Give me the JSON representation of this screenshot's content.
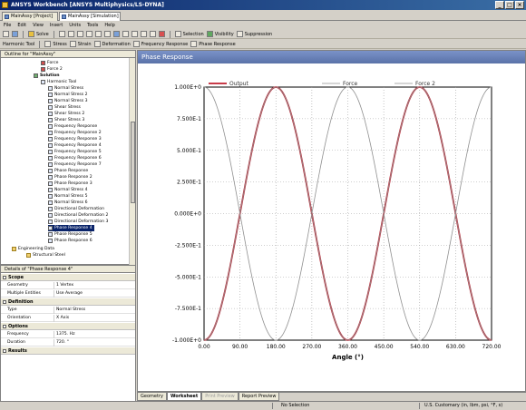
{
  "window": {
    "title": "ANSYS Workbench [ANSYS Multiphysics/LS-DYNA]"
  },
  "project_tabs": [
    {
      "label": "MainAssy [Project]"
    },
    {
      "label": "MainAssy [Simulation]"
    }
  ],
  "menu": [
    "File",
    "Edit",
    "View",
    "Insert",
    "Units",
    "Tools",
    "Help"
  ],
  "toolbar1": {
    "solve_label": "Solve",
    "selection_label": "Selection",
    "visibility_label": "Visibility",
    "suppression_label": "Suppression"
  },
  "toolbar2": {
    "context_label": "Harmonic Tool",
    "stress_label": "Stress",
    "strain_label": "Strain",
    "deformation_label": "Deformation",
    "freq_response_label": "Frequency Response",
    "phase_response_label": "Phase Response"
  },
  "outline": {
    "header": "Outline for \"MainAssy\"",
    "items": [
      {
        "label": "Force",
        "indent": 5,
        "icon": "force-icon"
      },
      {
        "label": "Force 2",
        "indent": 5,
        "icon": "force-icon"
      },
      {
        "label": "Solution",
        "indent": 4,
        "icon": "solution-icon",
        "bold": true
      },
      {
        "label": "Harmonic Tool",
        "indent": 5,
        "icon": "harmonic-tool-icon"
      },
      {
        "label": "Normal Stress",
        "indent": 6,
        "icon": "result-icon"
      },
      {
        "label": "Normal Stress 2",
        "indent": 6,
        "icon": "result-icon"
      },
      {
        "label": "Normal Stress 3",
        "indent": 6,
        "icon": "result-icon"
      },
      {
        "label": "Shear Stress",
        "indent": 6,
        "icon": "result-icon"
      },
      {
        "label": "Shear Stress 2",
        "indent": 6,
        "icon": "result-icon"
      },
      {
        "label": "Shear Stress 3",
        "indent": 6,
        "icon": "result-icon"
      },
      {
        "label": "Frequency Response",
        "indent": 6,
        "icon": "result-icon"
      },
      {
        "label": "Frequency Response 2",
        "indent": 6,
        "icon": "result-icon"
      },
      {
        "label": "Frequency Response 3",
        "indent": 6,
        "icon": "result-icon"
      },
      {
        "label": "Frequency Response 4",
        "indent": 6,
        "icon": "result-icon"
      },
      {
        "label": "Frequency Response 5",
        "indent": 6,
        "icon": "result-icon"
      },
      {
        "label": "Frequency Response 6",
        "indent": 6,
        "icon": "result-icon"
      },
      {
        "label": "Frequency Response 7",
        "indent": 6,
        "icon": "result-icon"
      },
      {
        "label": "Phase Response",
        "indent": 6,
        "icon": "result-icon"
      },
      {
        "label": "Phase Response 2",
        "indent": 6,
        "icon": "result-icon"
      },
      {
        "label": "Phase Response 3",
        "indent": 6,
        "icon": "result-icon"
      },
      {
        "label": "Normal Stress 4",
        "indent": 6,
        "icon": "result-icon"
      },
      {
        "label": "Normal Stress 5",
        "indent": 6,
        "icon": "result-icon"
      },
      {
        "label": "Normal Stress 6",
        "indent": 6,
        "icon": "result-icon"
      },
      {
        "label": "Directional Deformation",
        "indent": 6,
        "icon": "result-icon"
      },
      {
        "label": "Directional Deformation 2",
        "indent": 6,
        "icon": "result-icon"
      },
      {
        "label": "Directional Deformation 3",
        "indent": 6,
        "icon": "result-icon"
      },
      {
        "label": "Phase Response 4",
        "indent": 6,
        "icon": "result-icon",
        "selected": true
      },
      {
        "label": "Phase Response 5",
        "indent": 6,
        "icon": "result-icon"
      },
      {
        "label": "Phase Response 6",
        "indent": 6,
        "icon": "result-icon"
      },
      {
        "label": "Engineering Data",
        "indent": 1,
        "icon": "engineering-data-icon"
      },
      {
        "label": "Structural Steel",
        "indent": 3,
        "icon": "material-icon"
      }
    ]
  },
  "details": {
    "header": "Details of \"Phase Response 4\"",
    "groups": [
      {
        "title": "Scope",
        "rows": [
          {
            "key": "Geometry",
            "value": "1 Vertex"
          },
          {
            "key": "Multiple Entities",
            "value": "Use Average"
          }
        ]
      },
      {
        "title": "Definition",
        "rows": [
          {
            "key": "Type",
            "value": "Normal Stress"
          },
          {
            "key": "Orientation",
            "value": "X Axis"
          }
        ]
      },
      {
        "title": "Options",
        "rows": [
          {
            "key": "Frequency",
            "value": "1375. Hz"
          },
          {
            "key": "Duration",
            "value": "720. °"
          }
        ]
      },
      {
        "title": "Results",
        "rows": []
      }
    ]
  },
  "graph": {
    "title": "Phase Response"
  },
  "chart_data": {
    "type": "line",
    "xlabel": "Angle (°)",
    "ylabel": "",
    "xlim": [
      0,
      720
    ],
    "ylim": [
      -1,
      1
    ],
    "x_ticks": [
      "0.00",
      "90.00",
      "180.00",
      "270.00",
      "360.00",
      "450.00",
      "540.00",
      "630.00",
      "720.00"
    ],
    "y_ticks": [
      "1.000E+0",
      "7.500E-1",
      "5.000E-1",
      "2.500E-1",
      "0.000E+0",
      "-2.500E-1",
      "-5.000E-1",
      "-7.500E-1",
      "-1.000E+0"
    ],
    "y_tick_values": [
      1,
      0.75,
      0.5,
      0.25,
      0,
      -0.25,
      -0.5,
      -0.75,
      -1
    ],
    "grid": true,
    "legend_position": "top",
    "series": [
      {
        "name": "Output",
        "color": "#c02030",
        "phase_deg": 90,
        "function": "sin",
        "amplitude": 1,
        "period_deg": 360
      },
      {
        "name": "Force",
        "color": "#909090",
        "phase_deg": 0,
        "function": "cos",
        "amplitude": 1,
        "period_deg": 360
      },
      {
        "name": "Force 2",
        "color": "#909090",
        "phase_deg": 180,
        "function": "cos",
        "amplitude": 1,
        "period_deg": 360
      }
    ]
  },
  "bottom_tabs": [
    {
      "label": "Geometry"
    },
    {
      "label": "Worksheet"
    },
    {
      "label": "Print Preview"
    },
    {
      "label": "Report Preview"
    }
  ],
  "status": {
    "selection": "No Selection",
    "units": "U.S. Customary (in, lbm, psi, °F, s)"
  }
}
